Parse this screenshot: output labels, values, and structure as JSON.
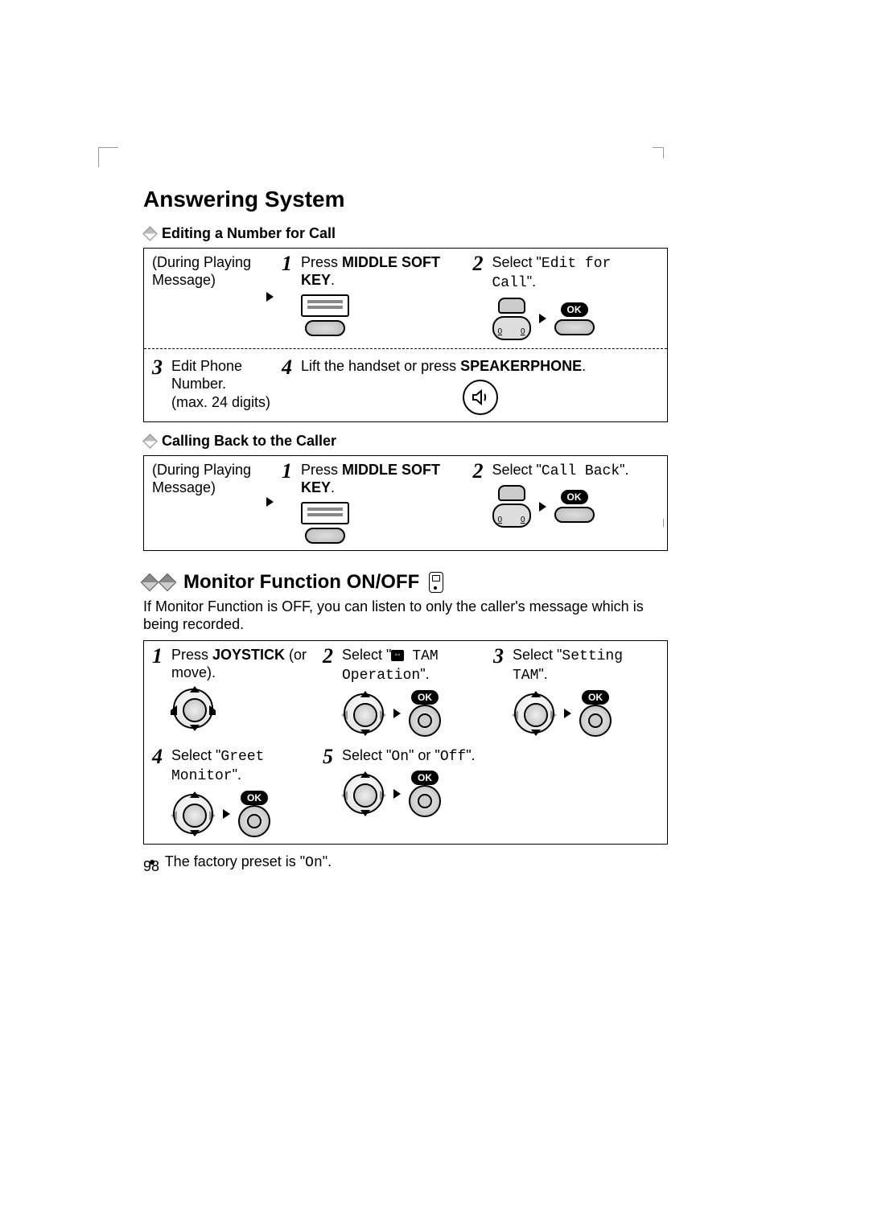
{
  "page": {
    "title": "Answering System",
    "number": "98"
  },
  "edit_call": {
    "heading": "Editing a Number for Call",
    "during": "(During Playing Message)",
    "step1": {
      "num": "1",
      "prefix": "Press ",
      "bold1": "MIDDLE SOFT KEY",
      "suffix": "."
    },
    "step2": {
      "num": "2",
      "prefix": "Select \"",
      "code": "Edit for Call",
      "suffix": "\"."
    },
    "step3": {
      "num": "3",
      "line1": "Edit Phone Number.",
      "line2": "(max. 24 digits)"
    },
    "step4": {
      "num": "4",
      "prefix": "Lift the handset or press ",
      "bold1": "SPEAKERPHONE",
      "suffix": "."
    }
  },
  "call_back": {
    "heading": "Calling Back to the Caller",
    "during": "(During Playing Message)",
    "step1": {
      "num": "1",
      "prefix": "Press ",
      "bold1": "MIDDLE SOFT KEY",
      "suffix": "."
    },
    "step2": {
      "num": "2",
      "prefix": "Select \"",
      "code": "Call Back",
      "suffix": "\"."
    }
  },
  "monitor": {
    "heading": "Monitor Function ON/OFF",
    "intro": "If Monitor Function is OFF, you can listen to only the caller's message which is being recorded.",
    "step1": {
      "num": "1",
      "prefix": "Press ",
      "bold1": "JOYSTICK",
      "suffix": " (or move)."
    },
    "step2": {
      "num": "2",
      "prefix": "Select \"",
      "tape_label": "",
      "code": " TAM Operation",
      "suffix": "\"."
    },
    "step3": {
      "num": "3",
      "prefix": "Select \"",
      "code": "Setting TAM",
      "suffix": "\"."
    },
    "step4": {
      "num": "4",
      "prefix": "Select \"",
      "code": "Greet Monitor",
      "suffix": "\"."
    },
    "step5": {
      "num": "5",
      "prefix": "Select \"",
      "code1": "On",
      "mid": "\" or \"",
      "code2": "Off",
      "suffix": "\"."
    },
    "note_prefix": "The factory preset is \"",
    "note_code": "On",
    "note_suffix": "\"."
  },
  "labels": {
    "ok": "OK",
    "tape_glyph": "◦◦"
  }
}
